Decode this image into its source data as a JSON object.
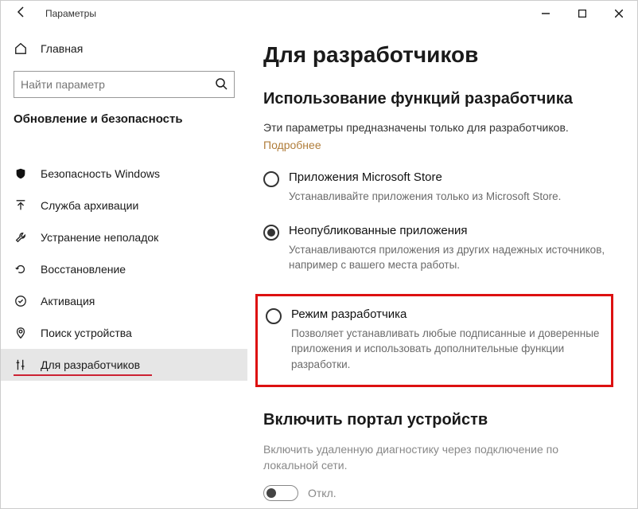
{
  "window": {
    "title": "Параметры"
  },
  "sidebar": {
    "home": "Главная",
    "search_placeholder": "Найти параметр",
    "section": "Обновление и безопасность",
    "items": [
      {
        "label": "Безопасность Windows"
      },
      {
        "label": "Служба архивации"
      },
      {
        "label": "Устранение неполадок"
      },
      {
        "label": "Восстановление"
      },
      {
        "label": "Активация"
      },
      {
        "label": "Поиск устройства"
      },
      {
        "label": "Для разработчиков"
      }
    ]
  },
  "content": {
    "title": "Для разработчиков",
    "section1_title": "Использование функций разработчика",
    "section1_desc": "Эти параметры предназначены только для разработчиков.",
    "learn_more": "Подробнее",
    "radios": [
      {
        "label": "Приложения Microsoft Store",
        "sub": "Устанавливайте приложения только из Microsoft Store."
      },
      {
        "label": "Неопубликованные приложения",
        "sub": "Устанавливаются приложения из других надежных источников, например с вашего места работы."
      },
      {
        "label": "Режим разработчика",
        "sub": "Позволяет устанавливать любые подписанные и доверенные приложения и использовать дополнительные функции разработки."
      }
    ],
    "section2_title": "Включить портал устройств",
    "section2_desc": "Включить удаленную диагностику через подключение по локальной сети.",
    "toggle_label": "Откл."
  }
}
